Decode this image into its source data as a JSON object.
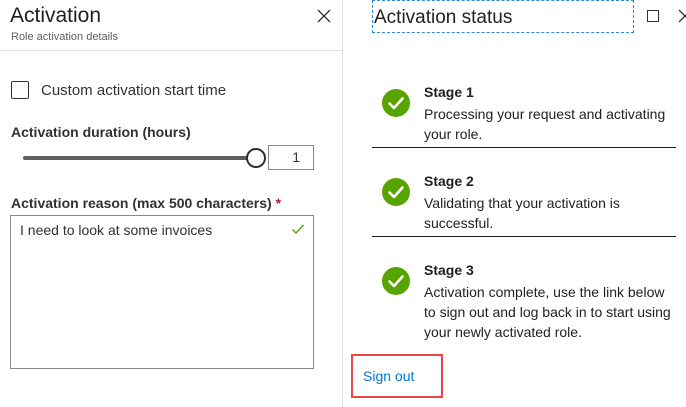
{
  "activation_panel": {
    "title": "Activation",
    "subtitle": "Role activation details",
    "custom_start_label": "Custom activation start time",
    "duration_label": "Activation duration (hours)",
    "duration_value": "1",
    "reason_label": "Activation reason (max 500 characters)",
    "required_marker": "*",
    "reason_value": "I need to look at some invoices"
  },
  "status_panel": {
    "title": "Activation status",
    "stages": [
      {
        "title": "Stage 1",
        "description": "Processing your request and activating your role."
      },
      {
        "title": "Stage 2",
        "description": "Validating that your activation is successful."
      },
      {
        "title": "Stage 3",
        "description": "Activation complete, use the link below to sign out and log back in to start using your newly activated role."
      }
    ],
    "sign_out_label": "Sign out"
  },
  "colors": {
    "success": "#57a300",
    "link": "#0078d4",
    "highlight": "#e8474c"
  }
}
